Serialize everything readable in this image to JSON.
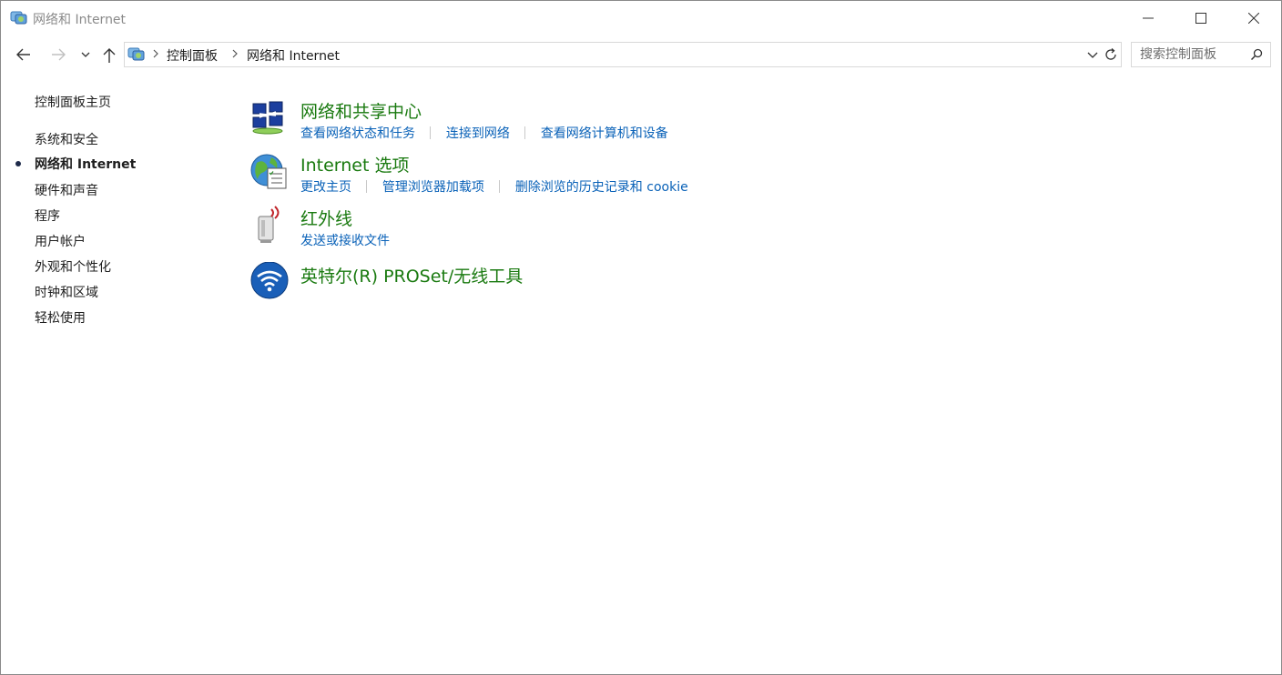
{
  "window": {
    "title": "网络和 Internet"
  },
  "address": {
    "breadcrumbs": [
      "控制面板",
      "网络和 Internet"
    ]
  },
  "search": {
    "placeholder": "搜索控制面板"
  },
  "sidebar": {
    "items": [
      {
        "label": "控制面板主页"
      },
      {
        "label": "系统和安全"
      },
      {
        "label": "网络和 Internet",
        "active": true
      },
      {
        "label": "硬件和声音"
      },
      {
        "label": "程序"
      },
      {
        "label": "用户帐户"
      },
      {
        "label": "外观和个性化"
      },
      {
        "label": "时钟和区域"
      },
      {
        "label": "轻松使用"
      }
    ]
  },
  "categories": [
    {
      "title": "网络和共享中心",
      "icon": "network-sharing-icon",
      "links": [
        "查看网络状态和任务",
        "连接到网络",
        "查看网络计算机和设备"
      ]
    },
    {
      "title": "Internet 选项",
      "icon": "internet-options-icon",
      "links": [
        "更改主页",
        "管理浏览器加载项",
        "删除浏览的历史记录和 cookie"
      ]
    },
    {
      "title": "红外线",
      "icon": "infrared-icon",
      "links": [
        "发送或接收文件"
      ]
    },
    {
      "title": "英特尔(R) PROSet/无线工具",
      "icon": "intel-wireless-icon",
      "links": []
    }
  ],
  "colors": {
    "category_title": "#1a7a10",
    "task_link": "#0a62b8",
    "title_text": "#8a8a8a"
  }
}
